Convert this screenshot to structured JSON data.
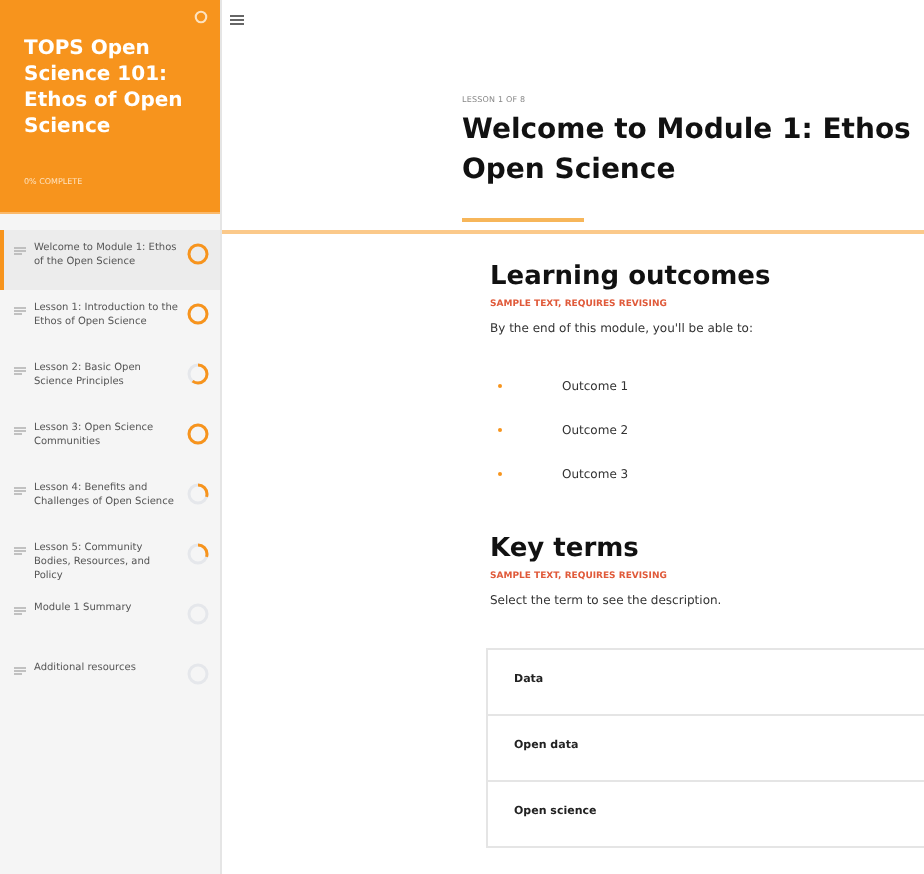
{
  "sidebar": {
    "course_title": "TOPS Open Science 101: Ethos of Open Science",
    "progress_label": "0% COMPLETE",
    "lessons": [
      {
        "title": "Welcome to Module 1: Ethos of the Open Science",
        "selected": true,
        "kind": "done"
      },
      {
        "title": "Lesson 1: Introduction to the Ethos of Open Science",
        "selected": false,
        "kind": "done"
      },
      {
        "title": "Lesson 2: Basic Open Science Principles",
        "selected": false,
        "kind": "partial"
      },
      {
        "title": "Lesson 3: Open Science Communities",
        "selected": false,
        "kind": "done"
      },
      {
        "title": "Lesson 4: Benefits and Challenges of Open Science",
        "selected": false,
        "kind": "started"
      },
      {
        "title": "Lesson 5: Community Bodies, Resources, and Policy",
        "selected": false,
        "kind": "started"
      },
      {
        "title": "Module 1 Summary",
        "selected": false,
        "kind": "empty"
      },
      {
        "title": "Additional resources",
        "selected": false,
        "kind": "empty"
      }
    ]
  },
  "header": {
    "lesson_count": "LESSON 1 OF 8",
    "title_lines": [
      "Welcome to Module 1: Ethos",
      "Open Science"
    ]
  },
  "outcomes": {
    "heading": "Learning outcomes",
    "note": "SAMPLE TEXT, REQUIRES REVISING",
    "intro": "By the end of this module, you'll be able to:",
    "items": [
      "Outcome 1",
      "Outcome 2",
      "Outcome 3"
    ]
  },
  "key_terms": {
    "heading": "Key terms",
    "note": "SAMPLE TEXT, REQUIRES REVISING",
    "intro": "Select the term to see the description.",
    "terms": [
      "Data",
      "Open data",
      "Open science"
    ]
  }
}
